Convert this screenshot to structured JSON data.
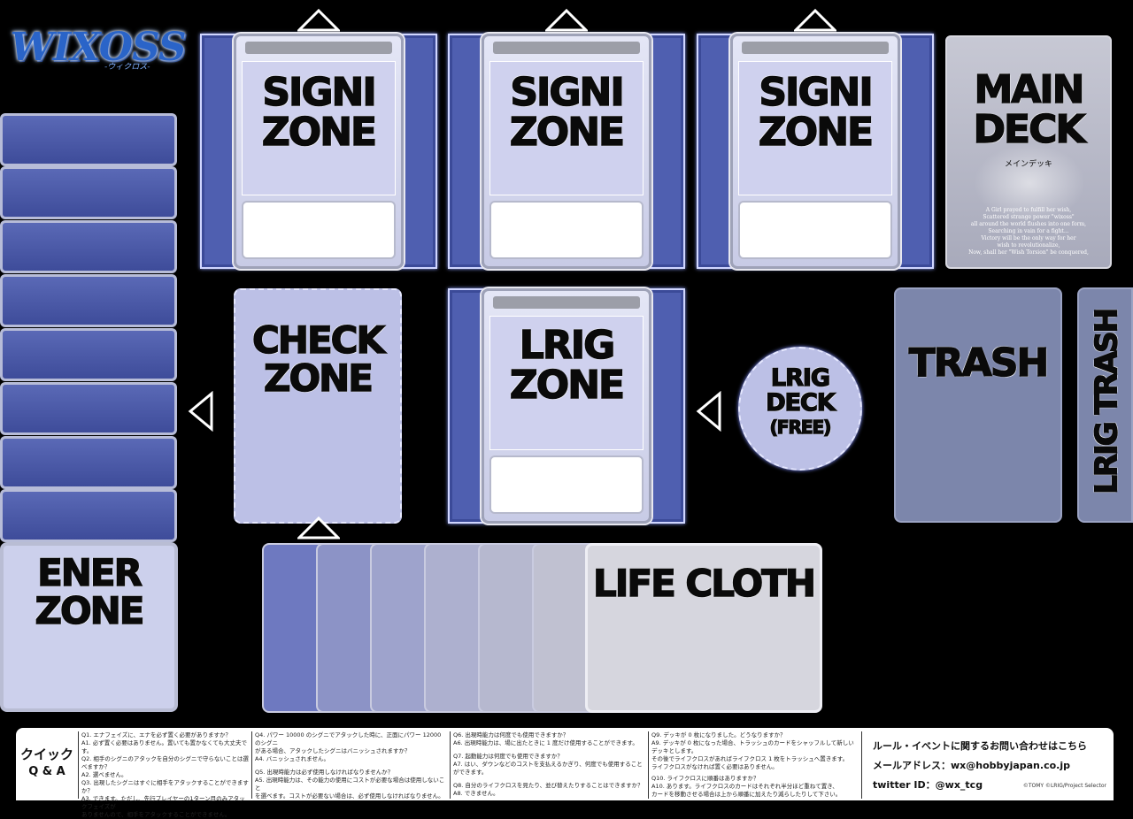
{
  "logo": {
    "text": "WIXOSS",
    "sub": "-ウィクロス-"
  },
  "signi_zones": [
    {
      "label_1": "SIGNI",
      "label_2": "ZONE"
    },
    {
      "label_1": "SIGNI",
      "label_2": "ZONE"
    },
    {
      "label_1": "SIGNI",
      "label_2": "ZONE"
    }
  ],
  "main_deck": {
    "label_1": "MAIN",
    "label_2": "DECK",
    "sub": "メインデッキ",
    "flavor": [
      "A Girl prayed to fulfill her wish,",
      "Scattered strange power \"wixoss\"",
      "all around the world flushes into one form,",
      "Searching in vain for a fight...",
      "Victory will be the only way for her",
      "wish to revolutionalize,",
      "Now, shall her \"Wish Torsion\" be conquered,"
    ]
  },
  "check_zone": {
    "label_1": "CHECK",
    "label_2": "ZONE"
  },
  "lrig_zone": {
    "label_1": "LRIG",
    "label_2": "ZONE"
  },
  "lrig_deck": {
    "label_1": "LRIG",
    "label_2": "DECK",
    "label_3": "(FREE)"
  },
  "trash": {
    "label": "TRASH"
  },
  "lrig_trash": {
    "label": "LRIG TRASH"
  },
  "ener_zone": {
    "label_1": "ENER",
    "label_2": "ZONE"
  },
  "life_cloth": {
    "label": "LIFE CLOTH"
  },
  "qa": {
    "title_1": "クイック",
    "title_2": "Q & A",
    "col1": [
      "Q1. エナフェイズに、エナを必ず置く必要がありますか？",
      "A1. 必ず置く必要はありません。置いても置かなくても大丈夫です。",
      "Q2. 相手のシグニのアタックを自分のシグニで守らないことは選べますか？",
      "A2. 選べません。",
      "Q3. 出現したシグニはすぐに相手をアタックすることができますか？",
      "A3. できます。ただし、先行プレイヤーの1ターン目のみアタックフェイズが",
      "ありませんので、相手をアタックすることができません。"
    ],
    "col2": [
      "Q4. パワー 10000 のシグニでアタックした時に、正面にパワー 12000 のシグニ",
      "がある場合、アタックしたシグニはバニッシュされますか？",
      "A4. バニッシュされません。",
      "Q5. 出現時能力は必ず使用しなければなりませんか？",
      "A5. 出現時能力は、その能力の使用にコストが必要な場合は使用しないこと",
      "を選べます。コストが必要ない場合は、必ず使用しなければなりません。"
    ],
    "col3": [
      "Q6. 出現時能力は何度でも使用できますか？",
      "A6. 出現時能力は、場に出たときに 1 度だけ使用することができます。",
      "Q7. 起動能力は何度でも使用できますか？",
      "A7. はい、ダウンなどのコストを支払えるかぎり、何度でも使用することができます。",
      "Q8. 自分のライフクロスを見たり、並び替えたりすることはできますか？",
      "A8. できません。"
    ],
    "col4": [
      "Q9. デッキが 0 枚になりました。どうなりますか？",
      "A9. デッキが 0 枚になった場合、トラッシュのカードをシャッフルして新しいデッキとします。",
      "その後でライフクロスがあればライフクロス 1 枚をトラッシュへ置きます。",
      "ライフクロスがなければ置く必要はありません。",
      "Q10. ライフクロスに順番はありますか？",
      "A10. あります。ライフクロスのカードはそれぞれ半分ほど重ねて置き、",
      "カードを移動させる場合は上から順番に加えたり減らしたりして下さい。"
    ],
    "contact_title": "ルール・イベントに関するお問い合わせはこちら",
    "mail_label": "メールアドレス：",
    "mail": "wx@hobbyjapan.co.jp",
    "twitter_label": "twitter ID：",
    "twitter": "@wx_tcg",
    "copyright": "©TOMY ©LRIG/Project Selector"
  }
}
